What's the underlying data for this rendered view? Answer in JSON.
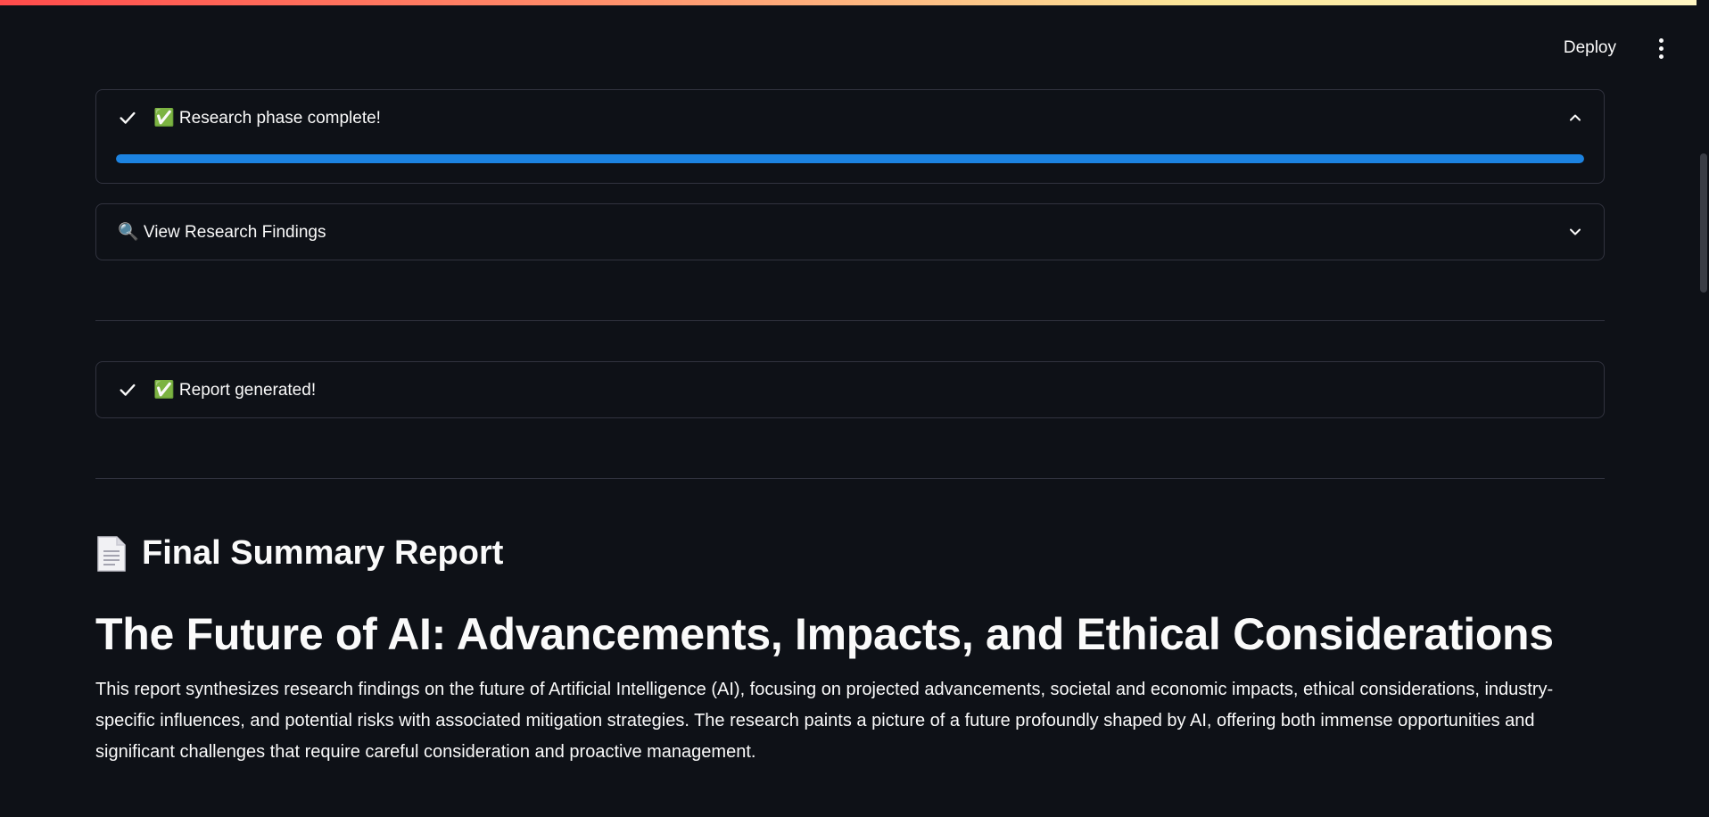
{
  "header": {
    "deploy_label": "Deploy",
    "menu_icon": "more-vertical-icon"
  },
  "research_expander": {
    "label": "✅ Research phase complete!",
    "status_icon": "check-icon",
    "chevron_icon": "chevron-up-icon",
    "progress_fraction": 1.0,
    "progress_color": "#1c83e1"
  },
  "findings_expander": {
    "label": "🔍 View Research Findings",
    "icon": "magnifier-icon",
    "chevron_icon": "chevron-down-icon"
  },
  "report_expander": {
    "label": "✅ Report generated!",
    "status_icon": "check-icon"
  },
  "report": {
    "icon": "document-icon",
    "heading": "Final Summary Report",
    "title": "The Future of AI: Advancements, Impacts, and Ethical Considerations",
    "intro": "This report synthesizes research findings on the future of Artificial Intelligence (AI), focusing on projected advancements, societal and economic impacts, ethical considerations, industry-specific influences, and potential risks with associated mitigation strategies. The research paints a picture of a future profoundly shaped by AI, offering both immense opportunities and significant challenges that require careful consideration and proactive management."
  },
  "colors": {
    "background": "#0e1117",
    "border": "#31333f",
    "accent": "#1c83e1",
    "success": "#2fb344",
    "text": "#fafafa"
  }
}
